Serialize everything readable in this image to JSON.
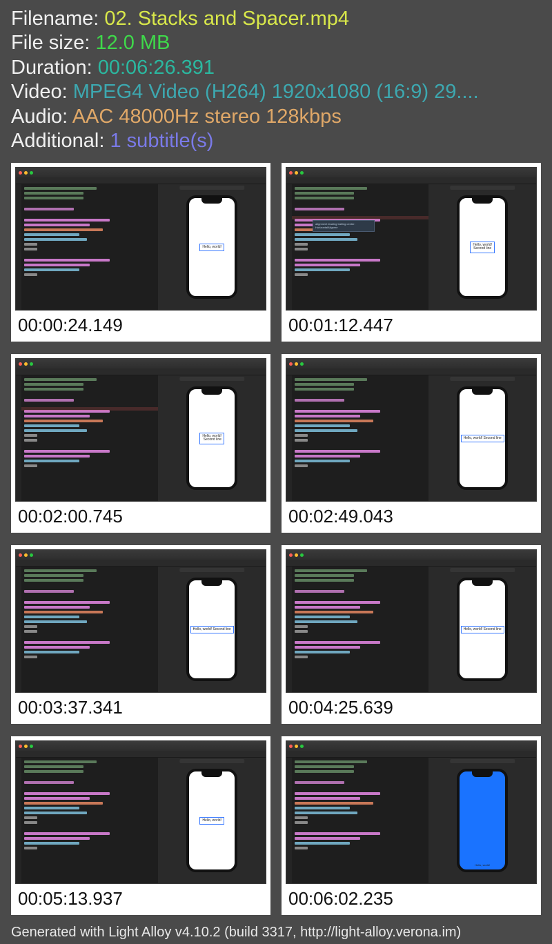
{
  "info": {
    "filename_label": "Filename: ",
    "filename_value": "02. Stacks and Spacer.mp4",
    "filesize_label": "File size: ",
    "filesize_value": "12.0 MB",
    "duration_label": "Duration: ",
    "duration_value": "00:06:26.391",
    "video_label": "Video: ",
    "video_value": "MPEG4 Video (H264) 1920x1080 (16:9) 29....",
    "audio_label": "Audio: ",
    "audio_value": "AAC 48000Hz stereo 128kbps",
    "additional_label": "Additional: ",
    "additional_value": "1 subtitle(s)"
  },
  "thumbs": [
    {
      "timestamp": "00:00:24.149",
      "type": "vstack-center",
      "phone_text_a": "Hello, world!",
      "phone_text_b": ""
    },
    {
      "timestamp": "00:01:12.447",
      "type": "vstack-tooltip",
      "phone_text_a": "Hello, world!",
      "phone_text_b": "Second line"
    },
    {
      "timestamp": "00:02:00.745",
      "type": "vstack-trailing",
      "phone_text_a": "Hello, world!",
      "phone_text_b": "Second line"
    },
    {
      "timestamp": "00:02:49.043",
      "type": "hstack",
      "phone_text_a": "Hello, world!",
      "phone_text_b": "Second line"
    },
    {
      "timestamp": "00:03:37.341",
      "type": "hstack",
      "phone_text_a": "Hello, world!",
      "phone_text_b": "Second line"
    },
    {
      "timestamp": "00:04:25.639",
      "type": "hstack",
      "phone_text_a": "Hello, world!",
      "phone_text_b": "Second line"
    },
    {
      "timestamp": "00:05:13.937",
      "type": "spacer",
      "phone_text_a": "Hello, world!",
      "phone_text_b": ""
    },
    {
      "timestamp": "00:06:02.235",
      "type": "zstack-blue",
      "phone_text_a": "Hello, world!",
      "phone_text_b": ""
    }
  ],
  "footer": "Generated with Light Alloy v4.10.2 (build 3317, http://light-alloy.verona.im)"
}
